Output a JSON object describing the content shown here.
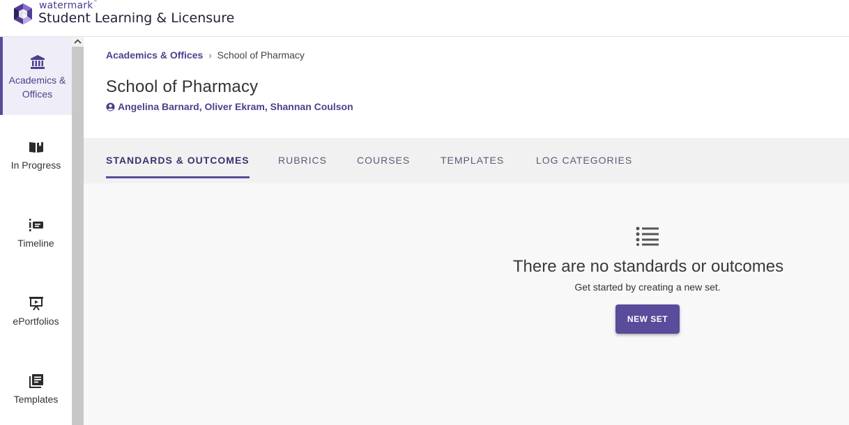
{
  "header": {
    "brand_small": "watermark",
    "brand_tm": "™",
    "brand_title": "Student Learning & Licensure"
  },
  "sidebar": {
    "items": [
      {
        "label": "Academics & Offices",
        "icon": "bank-icon",
        "active": true
      },
      {
        "label": "In Progress",
        "icon": "open-book-icon",
        "active": false
      },
      {
        "label": "Timeline",
        "icon": "timeline-icon",
        "active": false
      },
      {
        "label": "ePortfolios",
        "icon": "presentation-icon",
        "active": false
      },
      {
        "label": "Templates",
        "icon": "templates-icon",
        "active": false
      }
    ]
  },
  "breadcrumb": {
    "parent": "Academics & Offices",
    "separator": "›",
    "current": "School of Pharmacy"
  },
  "page": {
    "title": "School of Pharmacy",
    "owners": "Angelina Barnard, Oliver Ekram, Shannan Coulson"
  },
  "tabs": [
    {
      "label": "STANDARDS & OUTCOMES",
      "active": true
    },
    {
      "label": "RUBRICS",
      "active": false
    },
    {
      "label": "COURSES",
      "active": false
    },
    {
      "label": "TEMPLATES",
      "active": false
    },
    {
      "label": "LOG CATEGORIES",
      "active": false
    }
  ],
  "empty_state": {
    "icon": "list-icon",
    "title": "There are no standards or outcomes",
    "subtitle": "Get started by creating a new set.",
    "button": "NEW SET"
  },
  "colors": {
    "accent": "#5a4b9b",
    "accent_text": "#4f3e8c",
    "active_nav_bg": "#efedf7"
  }
}
